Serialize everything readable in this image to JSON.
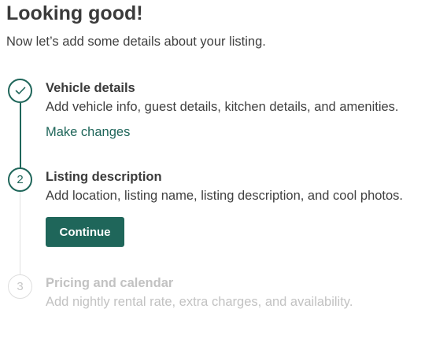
{
  "header": {
    "title": "Looking good!",
    "subtitle": "Now let’s add some details about your listing."
  },
  "steps": [
    {
      "number": "1",
      "status": "completed",
      "title": "Vehicle details",
      "description": "Add vehicle info, guest details, kitchen details, and amenities.",
      "action_label": "Make changes",
      "icon": "checkmark-icon"
    },
    {
      "number": "2",
      "status": "active",
      "title": "Listing description",
      "description": "Add location, listing name, listing description, and cool photos.",
      "action_label": "Continue"
    },
    {
      "number": "3",
      "status": "pending",
      "title": "Pricing and calendar",
      "description": "Add nightly rental rate, extra charges, and availability."
    }
  ],
  "colors": {
    "accent": "#1f665a",
    "pending": "#c2c2c2",
    "text": "#3b3b3b"
  }
}
